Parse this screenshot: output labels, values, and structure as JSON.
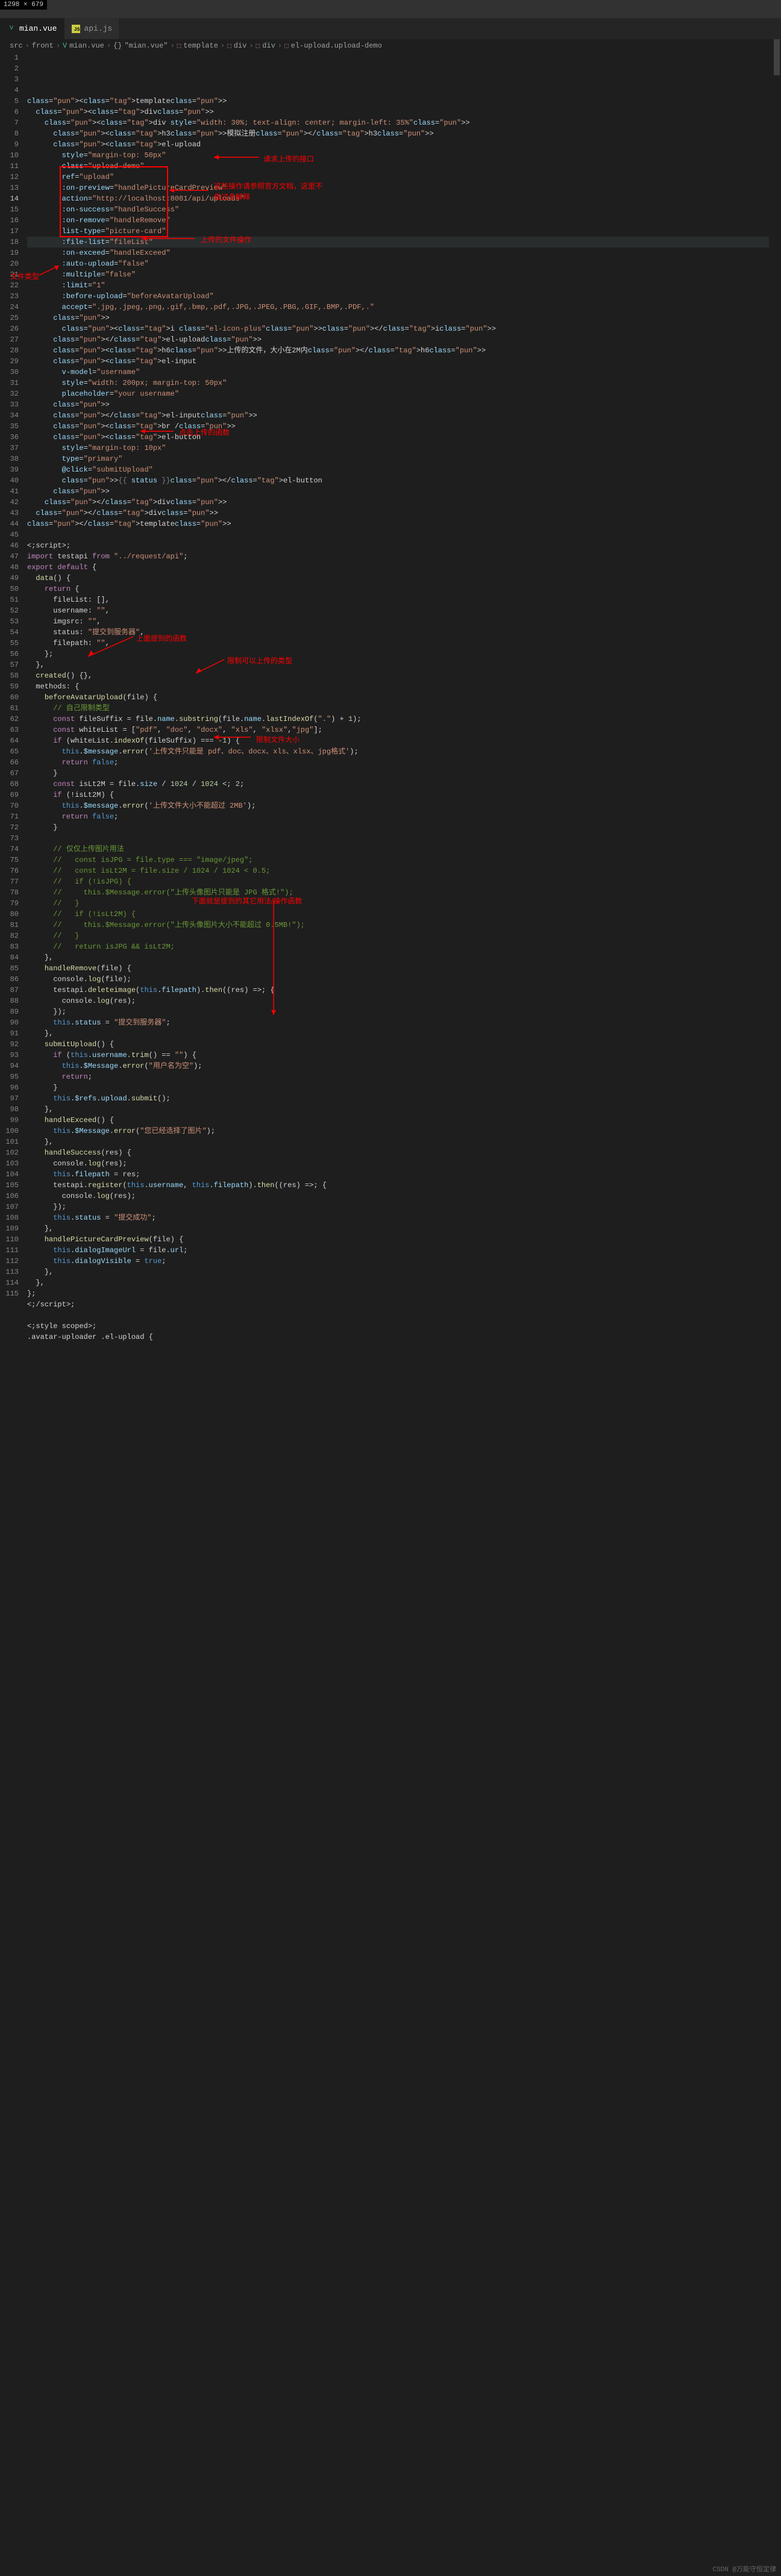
{
  "dimensions": "1298 × 679",
  "tabs": [
    {
      "icon": "V",
      "label": "mian.vue",
      "active": true
    },
    {
      "icon": "JS",
      "label": "api.js",
      "active": false
    }
  ],
  "breadcrumb": [
    "src",
    "front",
    "mian.vue",
    "{}",
    "\"mian.vue\"",
    "template",
    "div",
    "div",
    "el-upload.upload-demo"
  ],
  "highlight_line": 14,
  "annotations": {
    "a1": "请求上传的接口",
    "a2": "这些操作请参照官方文档，这里不做过多解释",
    "a3": "上传的文件操作",
    "a4": "文件类型",
    "a5": "点击上传的函数",
    "a6": "上面提到的函数",
    "a7": "限制可以上传的类型",
    "a8": "限制文件大小",
    "a9": "下面就是提到的其它用法/操作函数"
  },
  "code": [
    "<template>",
    "  <div>",
    "    <div style=\"width: 30%; text-align: center; margin-left: 35%\">",
    "      <h3>模拟注册</h3>",
    "      <el-upload",
    "        style=\"margin-top: 50px\"",
    "        class=\"upload-demo\"",
    "        ref=\"upload\"",
    "        :on-preview=\"handlePictureCardPreview\"",
    "        action=\"http://localhost:8081/api/uploads\"",
    "        :on-success=\"handleSuccess\"",
    "        :on-remove=\"handleRemove\"",
    "        list-type=\"picture-card\"",
    "        :file-list=\"fileList\"",
    "        :on-exceed=\"handleExceed\"",
    "        :auto-upload=\"false\"",
    "        :multiple=\"false\"",
    "        :limit=\"1\"",
    "        :before-upload=\"beforeAvatarUpload\"",
    "        accept=\".jpg,.jpeg,.png,.gif,.bmp,.pdf,.JPG,.JPEG,.PBG,.GIF,.BMP,.PDF,.\"",
    "      >",
    "        <i class=\"el-icon-plus\"></i>",
    "      </el-upload>",
    "      <h6>上传的文件，大小在2M内</h6>",
    "      <el-input",
    "        v-model=\"username\"",
    "        style=\"width: 200px; margin-top: 50px\"",
    "        placeholder=\"your username\"",
    "      >",
    "      </el-input>",
    "      <br />",
    "      <el-button",
    "        style=\"margin-top: 10px\"",
    "        type=\"primary\"",
    "        @click=\"submitUpload\"",
    "        >{{ status }}</el-button",
    "      >",
    "    </div>",
    "  </div>",
    "</template>",
    "",
    "<script>",
    "import testapi from \"../request/api\";",
    "export default {",
    "  data() {",
    "    return {",
    "      fileList: [],",
    "      username: \"\",",
    "      imgsrc: \"\",",
    "      status: \"提交到服务器\",",
    "      filepath: \"\",",
    "    };",
    "  },",
    "  created() {},",
    "  methods: {",
    "    beforeAvatarUpload(file) {",
    "      // 自己限制类型",
    "      const fileSuffix = file.name.substring(file.name.lastIndexOf(\".\") + 1);",
    "      const whiteList = [\"pdf\", \"doc\", \"docx\", \"xls\", \"xlsx\",\"jpg\"];",
    "      if (whiteList.indexOf(fileSuffix) === -1) {",
    "        this.$message.error('上传文件只能是 pdf、doc、docx、xls、xlsx、jpg格式');",
    "        return false;",
    "      }",
    "      const isLt2M = file.size / 1024 / 1024 < 2;",
    "      if (!isLt2M) {",
    "        this.$message.error('上传文件大小不能超过 2MB');",
    "        return false;",
    "      }",
    "",
    "      // 仅仅上传图片用法",
    "      //   const isJPG = file.type === \"image/jpeg\";",
    "      //   const isLt2M = file.size / 1024 / 1024 < 0.5;",
    "      //   if (!isJPG) {",
    "      //     this.$Message.error(\"上传头像图片只能是 JPG 格式!\");",
    "      //   }",
    "      //   if (!isLt2M) {",
    "      //     this.$Message.error(\"上传头像图片大小不能超过 0.5MB!\");",
    "      //   }",
    "      //   return isJPG && isLt2M;",
    "    },",
    "    handleRemove(file) {",
    "      console.log(file);",
    "      testapi.deleteimage(this.filepath).then((res) => {",
    "        console.log(res);",
    "      });",
    "      this.status = \"提交到服务器\";",
    "    },",
    "    submitUpload() {",
    "      if (this.username.trim() == \"\") {",
    "        this.$Message.error(\"用户名为空\");",
    "        return;",
    "      }",
    "      this.$refs.upload.submit();",
    "    },",
    "    handleExceed() {",
    "      this.$Message.error(\"您已经选择了图片\");",
    "    },",
    "    handleSuccess(res) {",
    "      console.log(res);",
    "      this.filepath = res;",
    "      testapi.register(this.username, this.filepath).then((res) => {",
    "        console.log(res);",
    "      });",
    "      this.status = \"提交成功\";",
    "    },",
    "    handlePictureCardPreview(file) {",
    "      this.dialogImageUrl = file.url;",
    "      this.dialogVisible = true;",
    "    },",
    "  },",
    "};",
    "</script>",
    "",
    "<style scoped>",
    ".avatar-uploader .el-upload {"
  ],
  "watermark": "CSDN @万能守恒定律"
}
